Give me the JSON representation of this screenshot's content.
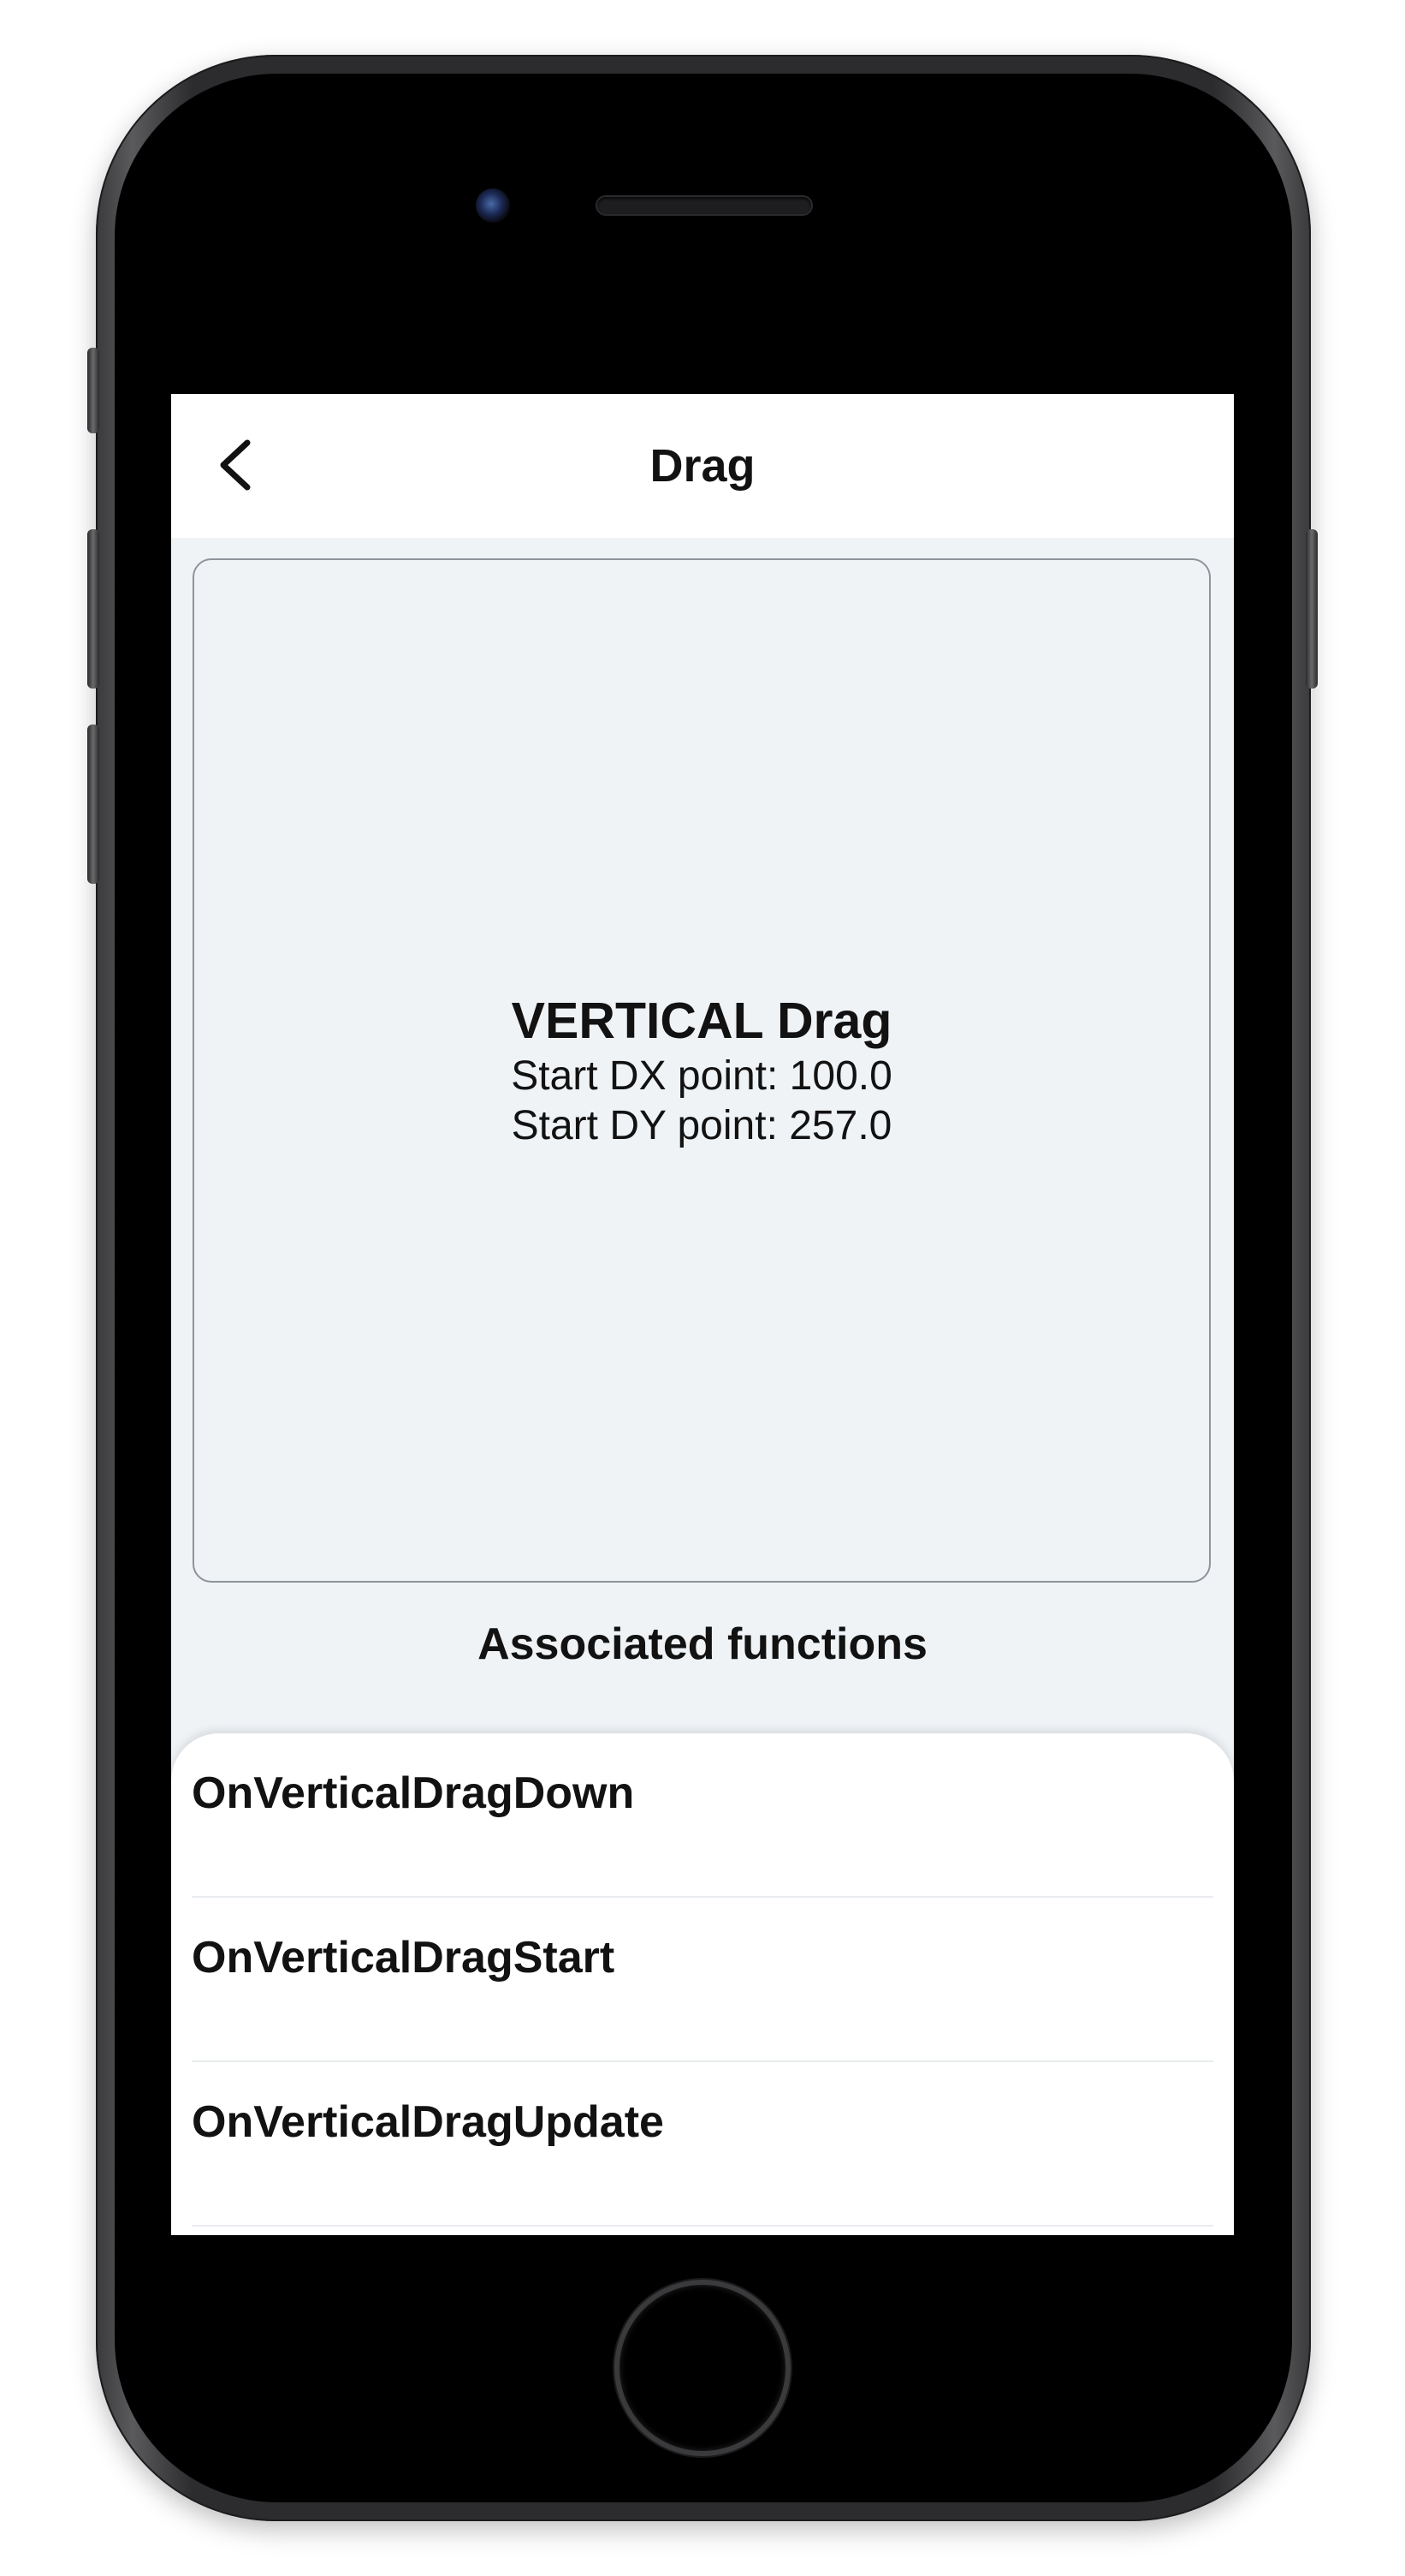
{
  "app_bar": {
    "title": "Drag",
    "back_icon": "chevron-left-icon"
  },
  "drag_area": {
    "heading": "VERTICAL Drag",
    "start_dx": "Start DX point: 100.0",
    "start_dy": "Start DY point: 257.0"
  },
  "associated": {
    "title": "Associated functions",
    "items": [
      {
        "label": "OnVerticalDragDown"
      },
      {
        "label": "OnVerticalDragStart"
      },
      {
        "label": "OnVerticalDragUpdate"
      }
    ]
  },
  "colors": {
    "screen_background": "#eff3f6",
    "drag_area_background": "#f0f3f6",
    "drag_area_border": "#8e9499",
    "text": "#121212",
    "sheet_background": "#ffffff"
  }
}
